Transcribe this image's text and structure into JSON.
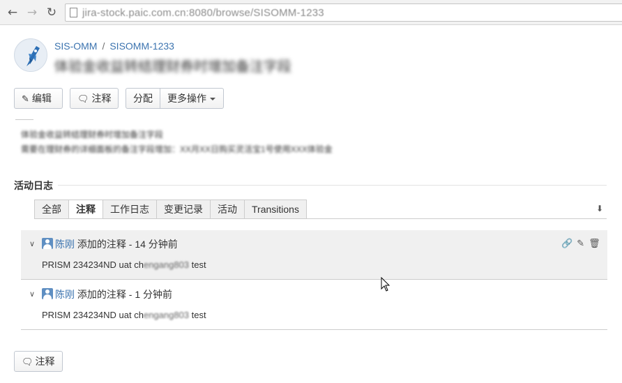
{
  "browser": {
    "url": "jira-stock.paic.com.cn:8080/browse/SISOMM-1233",
    "back_icon": "arrow-left-icon",
    "forward_icon": "arrow-right-icon",
    "reload_icon": "reload-icon"
  },
  "issue": {
    "project": "SIS-OMM",
    "separator": "/",
    "key": "SISOMM-1233",
    "title": "体验金收益转结理财券时增加备注字段",
    "avatar_icon": "rocket-icon"
  },
  "toolbar": {
    "edit_label": "编辑",
    "comment_label": "注释",
    "assign_label": "分配",
    "more_label": "更多操作"
  },
  "description": {
    "line1": "体验金收益转结理财券时增加备注字段",
    "line2": "需要在理财券的详细面板的备注字段增加：XX月XX日购买灵活宝1号使用XXX体验金"
  },
  "activity": {
    "heading": "活动日志",
    "tabs": [
      "全部",
      "注释",
      "工作日志",
      "变更记录",
      "活动",
      "Transitions"
    ],
    "active_tab": "注释",
    "comments": [
      {
        "author": "陈刚",
        "action": "添加的注释",
        "separator": " - ",
        "time": "14 分钟前",
        "body_prefix": "PRISM 234234ND uat ch",
        "body_redacted": "engang803",
        "body_suffix": " test",
        "highlighted": true
      },
      {
        "author": "陈刚",
        "action": "添加的注释",
        "separator": " - ",
        "time": "1 分钟前",
        "body_prefix": "PRISM 234234ND uat ch",
        "body_redacted": "engang803",
        "body_suffix": " test",
        "highlighted": false
      }
    ]
  },
  "footer": {
    "comment_label": "注释"
  },
  "colors": {
    "link": "#3b73af",
    "highlight_row": "#f0f0f0",
    "border": "#cccccc"
  }
}
